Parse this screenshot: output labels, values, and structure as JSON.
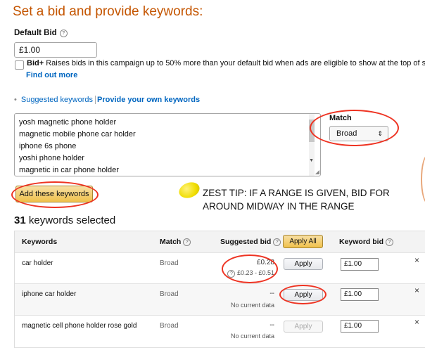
{
  "page": {
    "title": "Set a bid and provide keywords:",
    "default_bid_label": "Default Bid",
    "default_bid_value": "£1.00",
    "bid_plus_label": "Bid+",
    "bid_plus_text": " Raises bids in this campaign up to 50% more than your default bid when ads are eligible to show at the top of se",
    "find_out_more": "Find out more"
  },
  "tabs": {
    "suggested": "Suggested keywords",
    "own": "Provide your own keywords"
  },
  "keyword_list": [
    "yosh magnetic phone holder",
    "magnetic mobile phone car holder",
    "iphone 6s phone",
    "yoshi phone holder",
    "magnetic in car phone holder"
  ],
  "match": {
    "label": "Match",
    "selected": "Broad"
  },
  "add_button": "Add these keywords",
  "zest_tip": {
    "line1": "ZEST TIP: IF A RANGE IS GIVEN, BID FOR",
    "line2": "AROUND MIDWAY IN THE RANGE"
  },
  "selected_summary": {
    "count": "31",
    "text": " keywords selected"
  },
  "table": {
    "headers": {
      "keywords": "Keywords",
      "match": "Match",
      "suggested_bid": "Suggested bid",
      "apply_all": "Apply All",
      "keyword_bid": "Keyword bid"
    },
    "rows": [
      {
        "keyword": "car holder",
        "match": "Broad",
        "suggested": "£0.28",
        "sub": "£0.23 - £0.51",
        "apply": "Apply",
        "bid": "£1.00",
        "close": "×"
      },
      {
        "keyword": "iphone car holder",
        "match": "Broad",
        "suggested": "--",
        "sub": "No current data",
        "apply": "Apply",
        "bid": "£1.00",
        "close": "×"
      },
      {
        "keyword": "magnetic cell phone holder rose gold",
        "match": "Broad",
        "suggested": "--",
        "sub": "No current data",
        "apply": "Apply",
        "bid": "£1.00",
        "close": "×"
      }
    ]
  },
  "colors": {
    "title": "#c45500",
    "link": "#0066c0",
    "annotation": "#e32222",
    "button_yellow": "#f0c14b"
  }
}
